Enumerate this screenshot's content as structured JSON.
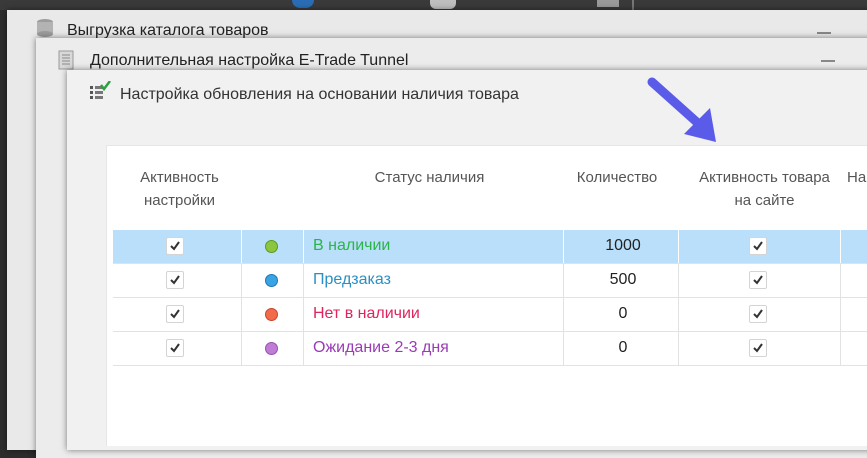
{
  "windows": {
    "export": {
      "title": "Выгрузка каталога товаров"
    },
    "etrade": {
      "title": "Дополнительная настройка E-Trade Tunnel"
    },
    "update": {
      "title": "Настройка обновления на основании наличия товара"
    }
  },
  "table": {
    "headers": {
      "active_line1": "Активность",
      "active_line2": "настройки",
      "status": "Статус наличия",
      "quantity": "Количество",
      "site_line1": "Активность товара",
      "site_line2": "на сайте",
      "cut_col": "На"
    },
    "rows": [
      {
        "status": "В наличии",
        "quantity": "1000",
        "color": "#2cb34a",
        "dot": "#8cc63f",
        "dot_border": "#5c9a1e",
        "active": true,
        "site_active": true,
        "selected": true
      },
      {
        "status": "Предзаказ",
        "quantity": "500",
        "color": "#2b8fc4",
        "dot": "#3aa3e3",
        "dot_border": "#1f77b4",
        "active": true,
        "site_active": true,
        "selected": false
      },
      {
        "status": "Нет в наличии",
        "quantity": "0",
        "color": "#e0245e",
        "dot": "#f26a4b",
        "dot_border": "#c9442a",
        "active": true,
        "site_active": true,
        "selected": false
      },
      {
        "status": "Ожидание 2-3 дня",
        "quantity": "0",
        "color": "#9b3bb5",
        "dot": "#c07bd6",
        "dot_border": "#9650b0",
        "active": true,
        "site_active": true,
        "selected": false
      }
    ]
  },
  "colors": {
    "selected_row": "#b9dffa",
    "arrow": "#5b5bea"
  }
}
